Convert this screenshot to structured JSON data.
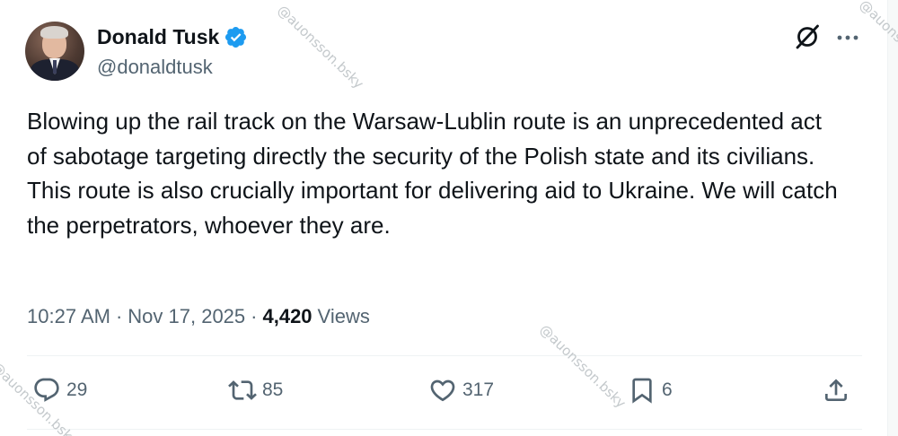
{
  "author": {
    "display_name": "Donald Tusk",
    "handle": "@donaldtusk",
    "verified": true,
    "verified_color": "#1d9bf0"
  },
  "tweet": {
    "text": "Blowing up the rail track on the Warsaw-Lublin route is an unprecedented act of sabotage targeting directly the security of the Polish state and its civilians. This route is also crucially important for delivering aid to Ukraine. We will catch the perpetrators, whoever they are."
  },
  "meta": {
    "time": "10:27 AM",
    "separator": "·",
    "date": "Nov 17, 2025",
    "views_count": "4,420",
    "views_label": "Views"
  },
  "actions": {
    "reply_count": "29",
    "repost_count": "85",
    "like_count": "317",
    "bookmark_count": "6"
  },
  "icons": {
    "header_right": [
      "grok-icon",
      "more-icon"
    ],
    "actions": [
      "reply-icon",
      "repost-icon",
      "like-icon",
      "bookmark-icon",
      "share-icon"
    ]
  },
  "watermark": {
    "text": "@auonsson.bsky"
  },
  "colors": {
    "primary_text": "#0f1419",
    "secondary_text": "#536471",
    "divider": "#eff3f4"
  }
}
